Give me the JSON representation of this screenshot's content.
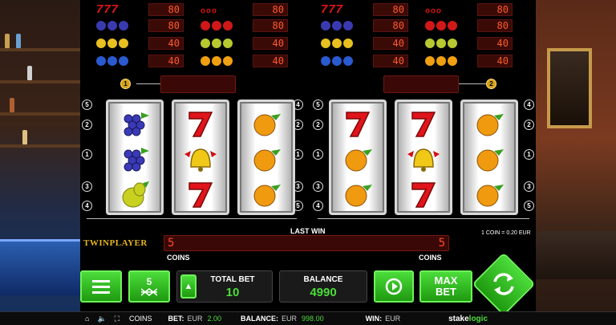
{
  "paytable_left": [
    {
      "symbol": "777",
      "value": "80",
      "symbol2": "cherries",
      "value2": "80"
    },
    {
      "symbol": "grapes",
      "value": "80",
      "symbol2": "strawberries",
      "value2": "80"
    },
    {
      "symbol": "bells",
      "value": "40",
      "symbol2": "pears",
      "value2": "40"
    },
    {
      "symbol": "plums",
      "value": "40",
      "symbol2": "oranges",
      "value2": "40"
    }
  ],
  "paytable_right": [
    {
      "symbol": "777",
      "value": "80",
      "symbol2": "cherries",
      "value2": "80"
    },
    {
      "symbol": "grapes",
      "value": "80",
      "symbol2": "strawberries",
      "value2": "80"
    },
    {
      "symbol": "bells",
      "value": "40",
      "symbol2": "pears",
      "value2": "40"
    },
    {
      "symbol": "plums",
      "value": "40",
      "symbol2": "oranges",
      "value2": "40"
    }
  ],
  "reelset_left": {
    "badge": "1",
    "reels": [
      [
        "grapes",
        "grapes",
        "pear"
      ],
      [
        "seven",
        "bell",
        "seven"
      ],
      [
        "orange",
        "orange",
        "orange"
      ]
    ]
  },
  "reelset_right": {
    "badge": "2",
    "reels": [
      [
        "seven",
        "orange",
        "orange"
      ],
      [
        "seven",
        "bell",
        "seven"
      ],
      [
        "orange",
        "orange",
        "orange"
      ]
    ]
  },
  "line_numbers_left": [
    "5",
    "2",
    "1",
    "3",
    "4"
  ],
  "line_numbers_right": [
    "4",
    "2",
    "1",
    "3",
    "5"
  ],
  "logo": "TWINPLAYER",
  "last_win_label": "LAST WIN",
  "coin_info": "1 COIN = 0.20 EUR",
  "last_win_left": "5",
  "last_win_right": "5",
  "coins_left": "COINS",
  "coins_right": "COINS",
  "controls": {
    "lines_value": "5",
    "total_bet_label": "TOTAL BET",
    "total_bet_value": "10",
    "balance_label": "BALANCE",
    "balance_value": "4990",
    "max_bet_line1": "MAX",
    "max_bet_line2": "BET"
  },
  "status": {
    "coins": "COINS",
    "bet_label": "BET:",
    "bet_currency": "EUR",
    "bet_value": "2.00",
    "balance_label": "BALANCE:",
    "balance_currency": "EUR",
    "balance_value": "998.00",
    "win_label": "WIN:",
    "win_currency": "EUR",
    "brand_prefix": "stake",
    "brand_suffix": "logic"
  },
  "colors": {
    "accent_green": "#4bdc3a",
    "led_red": "#ff4a2a",
    "logo_gold": "#e8b61a"
  }
}
